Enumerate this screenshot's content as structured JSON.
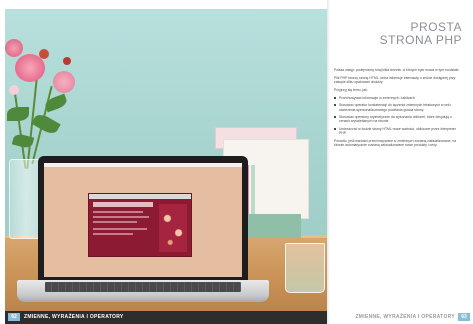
{
  "right_page": {
    "title_line1": "PROSTA",
    "title_line2": "STRONA PHP",
    "paragraphs": [
      "Polska wstęp: podejmiemy tutaj kilka technik, w których było mowa w tym rozdziale.",
      "Plik PHP tworzy stronę HTML, która informuje internautę o zniżce dostępnej przy zakupie kilku opakowań drożdży.",
      "Przyjrzyj się temu, jak:"
    ],
    "bullets": [
      "Przechowywać informacje w zmiennych i tablicach",
      "Stosować operator konkatenacji do łączenia zmiennych tekstowych w celu utworzenia spersonalizowanego powitania gościa strony.",
      "Stosować operatory arytmetyczne do wykonania obliczeń, które decydują o cenach wyświetlanych na stronie.",
      "Umieszczać w kodzie strony HTML nowe wartości, obliczone przez interpreter PHP."
    ],
    "closing": "Ponadto, jeśli wartości przechowywane w zmiennych zostaną zaktualizowane, na stronie automatycznie zostaną zaktualizowane nowe produkty i ceny."
  },
  "footer": {
    "left_page_number": "62",
    "left_label": "ZMIENNE, WYRAŻENIA I OPERATORY",
    "right_label": "ZMIENNE, WYRAŻENIA I OPERATORY",
    "right_page_number": "63"
  },
  "colors": {
    "footer_dark": "#2e2c2c",
    "page_number_badge": "#8cbcd6",
    "title_gray": "#8c8f97"
  }
}
